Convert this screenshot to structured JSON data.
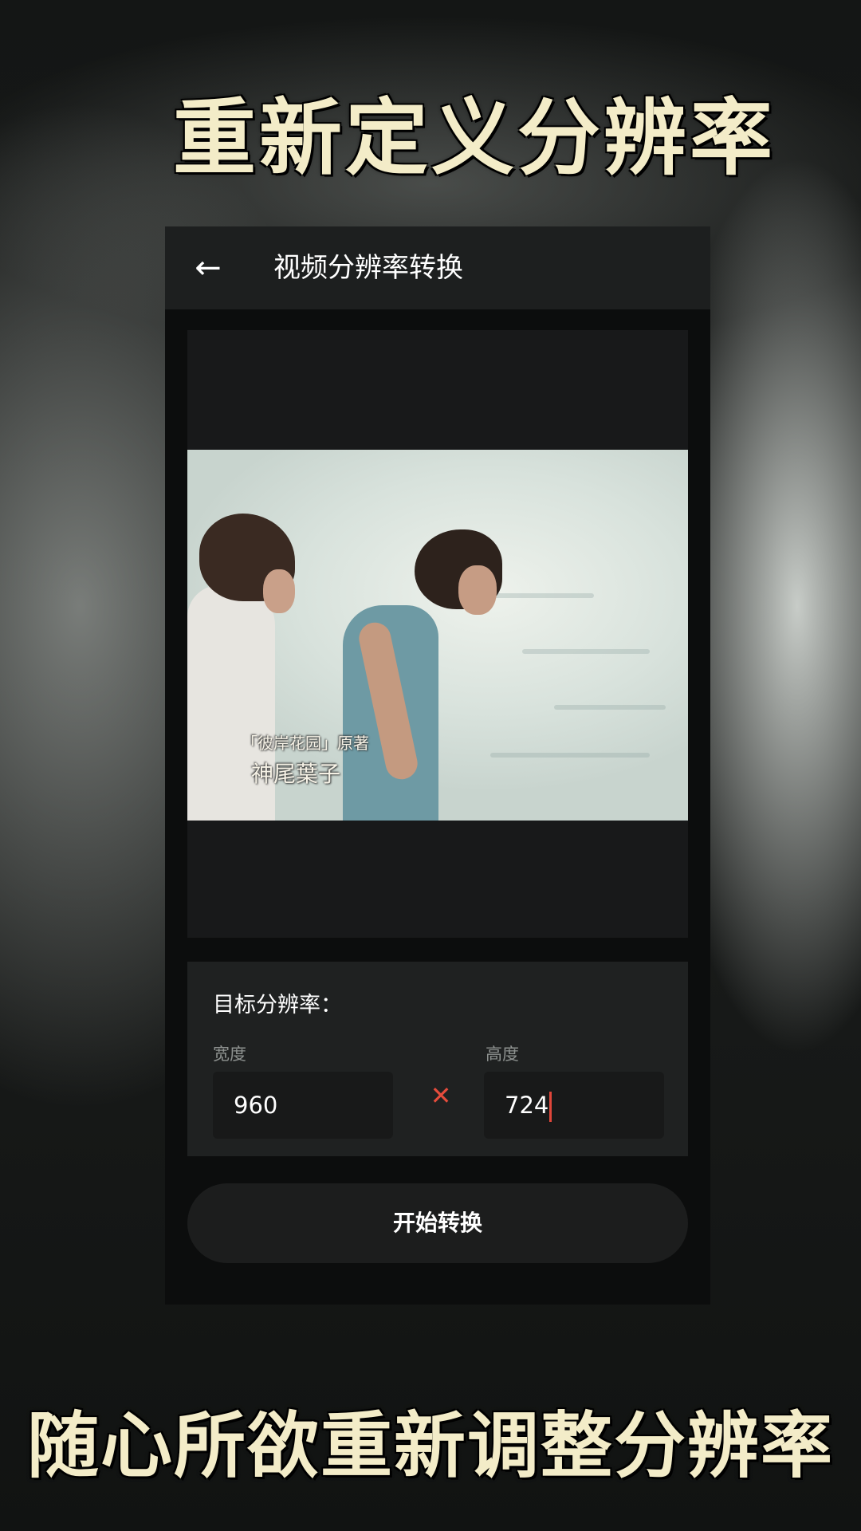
{
  "overlay": {
    "headline_top": "重新定义分辨率",
    "headline_bottom": "随心所欲重新调整分辨率"
  },
  "appbar": {
    "back_icon": "arrow-left-icon",
    "title": "视频分辨率转换"
  },
  "preview": {
    "subtitle_line1": "「彼岸花园」原著",
    "subtitle_line2": "神尾葉子"
  },
  "settings": {
    "section_title": "目标分辨率：",
    "width_label": "宽度",
    "width_value": "960",
    "times_icon": "multiply-icon",
    "height_label": "高度",
    "height_value": "724"
  },
  "actions": {
    "start_label": "开始转换"
  },
  "colors": {
    "headline_text": "#f3ecc8",
    "accent_red": "#e64c3c",
    "card_bg": "#1f2121",
    "input_bg": "#181919"
  }
}
